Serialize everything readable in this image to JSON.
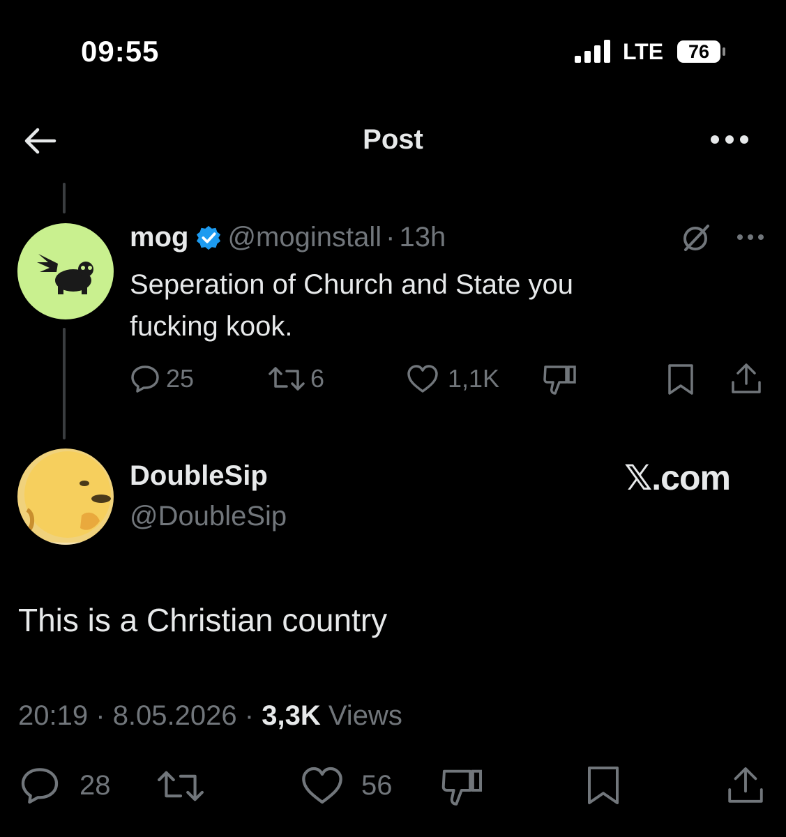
{
  "status_bar": {
    "time": "09:55",
    "network": "LTE",
    "battery": "76"
  },
  "header": {
    "title": "Post"
  },
  "reply": {
    "name": "mog",
    "handle": "@moginstall",
    "separator": "·",
    "age": "13h",
    "text": "Seperation of Church and State you fucking kook.",
    "counts": {
      "replies": "25",
      "reposts": "6",
      "likes": "1,1K"
    }
  },
  "main": {
    "name": "DoubleSip",
    "handle": "@DoubleSip",
    "watermark": "𝕏.com",
    "text": "This is a Christian country",
    "time": "20:19",
    "date": "8.05.2026",
    "views_count": "3,3K",
    "views_label": "Views",
    "counts": {
      "replies": "28",
      "likes": "56"
    }
  },
  "colors": {
    "background": "#000000",
    "text": "#e7e9ea",
    "muted": "#71767b",
    "verified": "#1d9bf0",
    "thread_line": "#3a3d40"
  },
  "icons": [
    "signal-icon",
    "battery-icon",
    "back-arrow-icon",
    "more-icon",
    "verified-badge-icon",
    "grok-icon",
    "reply-icon",
    "repost-icon",
    "like-icon",
    "dislike-icon",
    "bookmark-icon",
    "share-icon"
  ]
}
